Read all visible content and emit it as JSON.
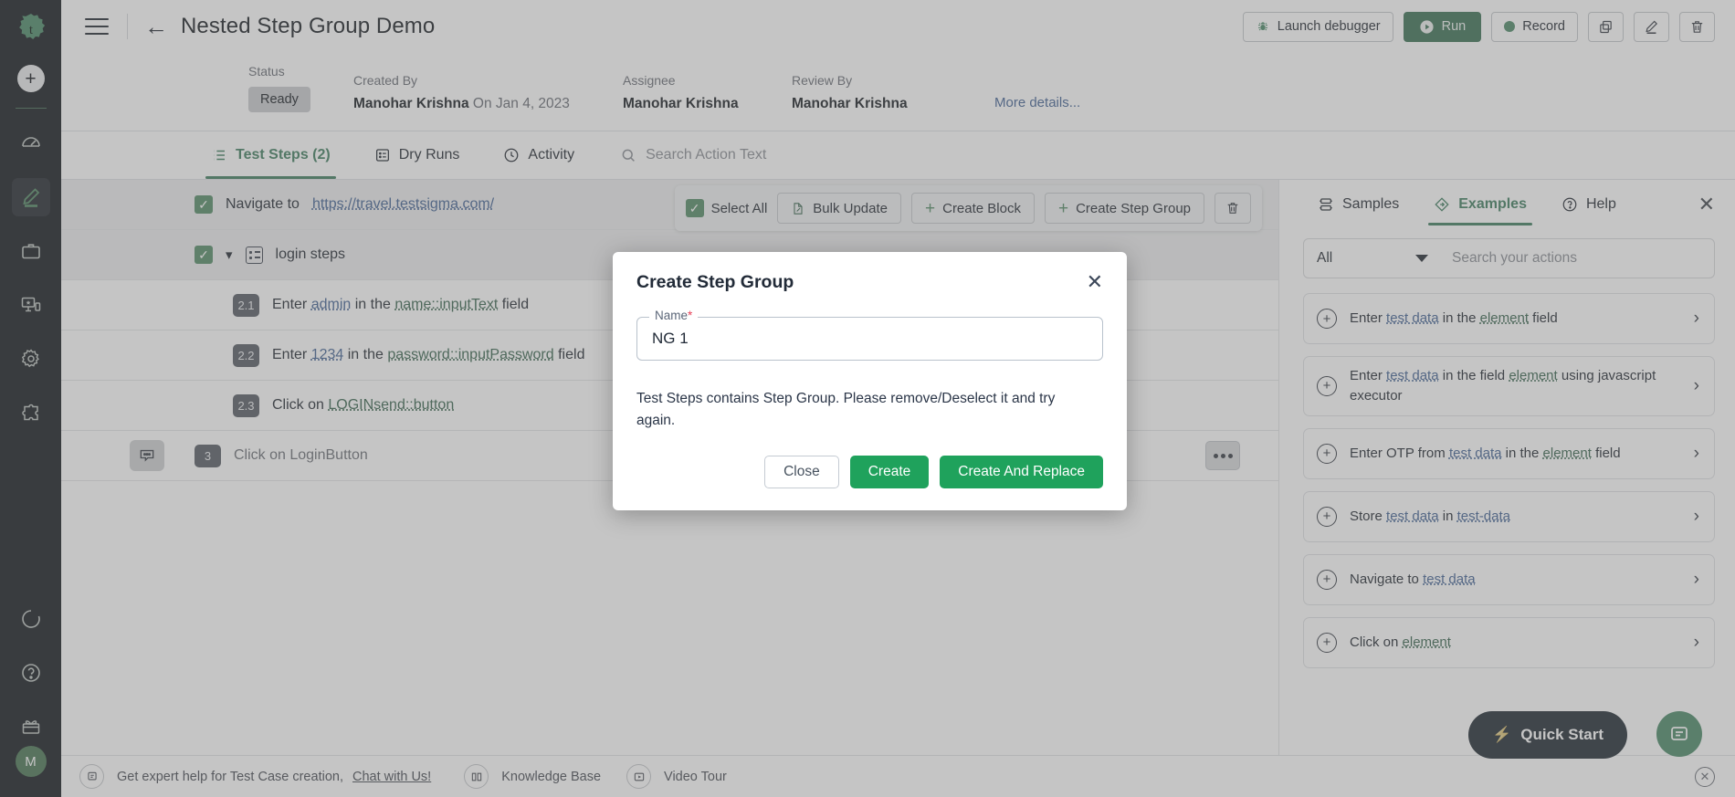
{
  "rail": {
    "logo_icon": "testsigma-logo-icon",
    "add_icon": "plus-icon",
    "items": [
      {
        "name": "dashboard",
        "icon": "speedometer-icon"
      },
      {
        "name": "create",
        "icon": "pencil-icon",
        "active": true
      },
      {
        "name": "projects",
        "icon": "briefcase-icon"
      },
      {
        "name": "devices",
        "icon": "devices-icon"
      },
      {
        "name": "settings",
        "icon": "gear-icon"
      },
      {
        "name": "addons",
        "icon": "puzzle-icon"
      }
    ],
    "bottom_items": [
      {
        "name": "progress",
        "icon": "progress-circle-icon"
      },
      {
        "name": "help",
        "icon": "question-circle-icon"
      },
      {
        "name": "gifts",
        "icon": "gift-icon"
      }
    ],
    "avatar_initial": "M"
  },
  "topbar": {
    "title": "Nested Step Group Demo",
    "back_icon": "arrow-left-icon",
    "menu_icon": "hamburger-icon",
    "launch_debugger": "Launch debugger",
    "run": "Run",
    "record": "Record",
    "copy_icon": "copy-icon",
    "edit_icon": "pencil-edit-icon",
    "delete_icon": "trash-icon"
  },
  "meta": {
    "status_label": "Status",
    "status_value": "Ready",
    "created_by_label": "Created By",
    "created_by_value": "Manohar Krishna",
    "created_on": "On Jan 4, 2023",
    "assignee_label": "Assignee",
    "assignee_value": "Manohar Krishna",
    "review_by_label": "Review By",
    "review_by_value": "Manohar Krishna",
    "more_details": "More details..."
  },
  "tabs": {
    "test_steps": "Test Steps (2)",
    "dry_runs": "Dry Runs",
    "activity": "Activity",
    "search_placeholder": "Search Action Text"
  },
  "step_toolbar": {
    "select_all": "Select All",
    "bulk_update": "Bulk Update",
    "create_block": "Create Block",
    "create_step_group": "Create Step Group",
    "delete_icon": "trash-icon"
  },
  "steps": [
    {
      "id": "1",
      "checked": true,
      "type": "navigate",
      "prefix": "Navigate to",
      "link": "https://travel.testsigma.com/",
      "shaded": true
    },
    {
      "id": "2",
      "checked": true,
      "type": "group",
      "label": "login steps",
      "shaded": true,
      "expand_icon": "chevron-down-icon",
      "group_icon": "step-group-icon"
    },
    {
      "id": "2.1",
      "type": "nested",
      "parts": [
        {
          "t": "Enter",
          "k": "plain"
        },
        {
          "t": "admin",
          "k": "data"
        },
        {
          "t": "in the",
          "k": "plain"
        },
        {
          "t": "name::inputText",
          "k": "elem"
        },
        {
          "t": "field",
          "k": "plain"
        }
      ]
    },
    {
      "id": "2.2",
      "type": "nested",
      "parts": [
        {
          "t": "Enter",
          "k": "plain"
        },
        {
          "t": "1234",
          "k": "data"
        },
        {
          "t": "in the",
          "k": "plain"
        },
        {
          "t": "password::inputPassword",
          "k": "elem"
        },
        {
          "t": "field",
          "k": "plain"
        }
      ]
    },
    {
      "id": "2.3",
      "type": "nested",
      "parts": [
        {
          "t": "Click on",
          "k": "plain"
        },
        {
          "t": "LOGINsend::button",
          "k": "elem"
        }
      ]
    },
    {
      "id": "3",
      "type": "plain",
      "text": "Click on LoginButton",
      "comment_icon": "comment-icon",
      "menu_icon": "more-horizontal-icon"
    }
  ],
  "right_panel": {
    "tabs": [
      {
        "label": "Samples",
        "icon": "samples-icon",
        "active": false
      },
      {
        "label": "Examples",
        "icon": "examples-diamond-icon",
        "active": true
      },
      {
        "label": "Help",
        "icon": "question-circle-icon",
        "active": false
      }
    ],
    "close_icon": "close-icon",
    "filter_value": "All",
    "search_placeholder": "Search your actions",
    "cards": [
      {
        "parts": [
          {
            "t": "Enter",
            "k": "plain"
          },
          {
            "t": "test data",
            "k": "data"
          },
          {
            "t": "in the",
            "k": "plain"
          },
          {
            "t": "element",
            "k": "elem"
          },
          {
            "t": "field",
            "k": "plain"
          }
        ]
      },
      {
        "parts": [
          {
            "t": "Enter",
            "k": "plain"
          },
          {
            "t": "test data",
            "k": "data"
          },
          {
            "t": "in the field",
            "k": "plain"
          },
          {
            "t": "element",
            "k": "elem"
          },
          {
            "t": "using javascript executor",
            "k": "plain"
          }
        ]
      },
      {
        "parts": [
          {
            "t": "Enter OTP from",
            "k": "plain"
          },
          {
            "t": "test data",
            "k": "data"
          },
          {
            "t": "in the",
            "k": "plain"
          },
          {
            "t": "element",
            "k": "elem"
          },
          {
            "t": "field",
            "k": "plain"
          }
        ]
      },
      {
        "parts": [
          {
            "t": "Store",
            "k": "plain"
          },
          {
            "t": "test data",
            "k": "data"
          },
          {
            "t": "in",
            "k": "plain"
          },
          {
            "t": "test-data",
            "k": "data"
          }
        ]
      },
      {
        "parts": [
          {
            "t": "Navigate to",
            "k": "plain"
          },
          {
            "t": "test data",
            "k": "data"
          }
        ]
      },
      {
        "parts": [
          {
            "t": "Click on",
            "k": "plain"
          },
          {
            "t": "element",
            "k": "elem"
          }
        ]
      }
    ]
  },
  "bottombar": {
    "chat_icon": "chat-bubble-icon",
    "expert_text": "Get expert help for Test Case creation,",
    "chat_link": "Chat with Us!",
    "knowledge_base": "Knowledge Base",
    "knowledge_icon": "book-icon",
    "video_tour": "Video Tour",
    "video_icon": "video-play-icon",
    "close_icon": "close-circle-icon"
  },
  "floating": {
    "quick_start": "Quick Start",
    "bolt_icon": "bolt-icon",
    "chat_fab_icon": "chat-icon"
  },
  "modal": {
    "title": "Create Step Group",
    "close_icon": "close-icon",
    "field_label": "Name",
    "field_required_mark": "*",
    "field_value": "NG 1",
    "message": "Test Steps contains Step Group. Please remove/Deselect it and try again.",
    "close_button": "Close",
    "create_button": "Create",
    "create_replace_button": "Create And Replace"
  },
  "colors": {
    "brand_green": "#1fa25c",
    "dark_green": "#18874e",
    "rail_bg": "#1e2732",
    "link_blue": "#2d6fd6",
    "element_green": "#1f7a4d",
    "required_red": "#e8435a"
  }
}
